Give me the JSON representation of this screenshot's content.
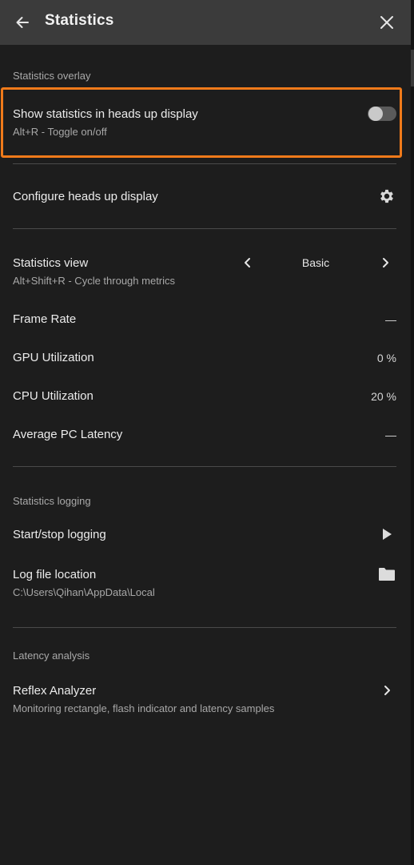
{
  "header": {
    "title": "Statistics",
    "back_icon": "arrow-left-icon",
    "close_icon": "close-icon"
  },
  "overlay": {
    "section_label": "Statistics overlay",
    "show_stats": {
      "title": "Show statistics in heads up display",
      "subtitle": "Alt+R - Toggle on/off",
      "enabled": false
    },
    "configure": {
      "title": "Configure heads up display",
      "icon": "gear-icon"
    },
    "view": {
      "title": "Statistics view",
      "subtitle": "Alt+Shift+R - Cycle through metrics",
      "selected": "Basic"
    },
    "metrics": [
      {
        "label": "Frame Rate",
        "value": "—"
      },
      {
        "label": "GPU Utilization",
        "value": "0 %"
      },
      {
        "label": "CPU Utilization",
        "value": "20 %"
      },
      {
        "label": "Average PC Latency",
        "value": "—"
      }
    ]
  },
  "logging": {
    "section_label": "Statistics logging",
    "start_stop": {
      "title": "Start/stop logging",
      "icon": "play-icon"
    },
    "location": {
      "title": "Log file location",
      "path": "C:\\Users\\Qihan\\AppData\\Local",
      "icon": "folder-icon"
    }
  },
  "latency": {
    "section_label": "Latency analysis",
    "reflex": {
      "title": "Reflex Analyzer",
      "subtitle": "Monitoring rectangle, flash indicator and latency samples",
      "icon": "chevron-right-icon"
    }
  },
  "colors": {
    "accent": "#f07a1a",
    "header_bg": "#3b3b3b",
    "panel_bg": "#1d1d1d"
  }
}
